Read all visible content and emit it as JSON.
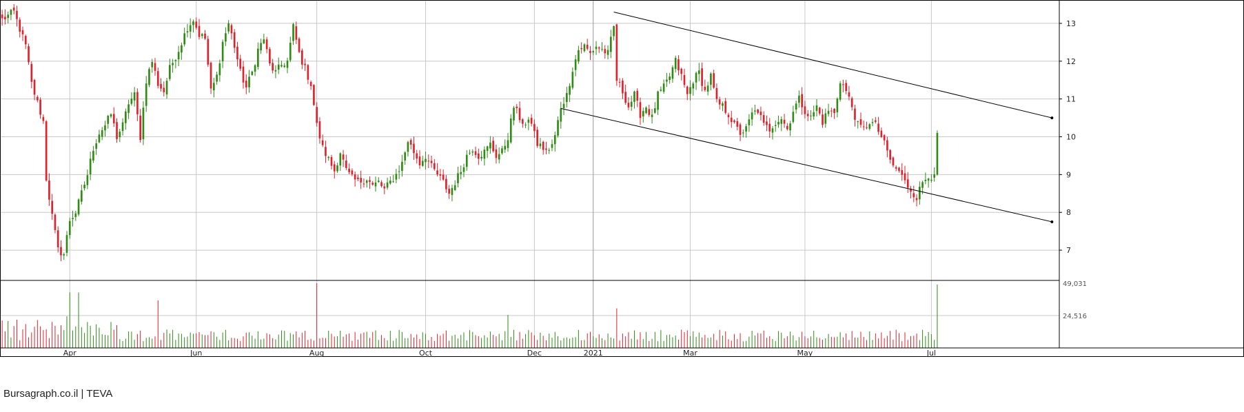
{
  "watermark": "Bursagraph.co.il | TEVA",
  "colors": {
    "up": "#2e8b14",
    "down": "#e0212b",
    "grid": "#c8c8c8",
    "frame": "#000000",
    "trend": "#000000"
  },
  "chart_data": {
    "type": "candlestick",
    "title": "",
    "ticker": "TEVA",
    "price_ylim": [
      6.2,
      13.6
    ],
    "price_ticks": [
      7,
      8,
      9,
      10,
      11,
      12,
      13
    ],
    "volume_ylim": [
      0,
      49031
    ],
    "volume_ticks": [
      "49,031",
      "24,516"
    ],
    "volume_tick_values": [
      49031,
      24516
    ],
    "x_tick_labels": [
      {
        "label": "Apr",
        "index": 23
      },
      {
        "label": "Jun",
        "index": 66
      },
      {
        "label": "Aug",
        "index": 107
      },
      {
        "label": "Oct",
        "index": 144
      },
      {
        "label": "Dec",
        "index": 181
      },
      {
        "label": "2021",
        "index": 201
      },
      {
        "label": "Mar",
        "index": 234
      },
      {
        "label": "May",
        "index": 273
      },
      {
        "label": "Jul",
        "index": 316
      }
    ],
    "grid": true,
    "last_close": 10.1,
    "anchors": [
      [
        0,
        13.1
      ],
      [
        4,
        13.3
      ],
      [
        8,
        12.4
      ],
      [
        10,
        11.4
      ],
      [
        12,
        10.9
      ],
      [
        14,
        10.4
      ],
      [
        15,
        8.9
      ],
      [
        17,
        7.9
      ],
      [
        19,
        7.0
      ],
      [
        21,
        6.9
      ],
      [
        23,
        7.8
      ],
      [
        25,
        8.0
      ],
      [
        27,
        8.5
      ],
      [
        29,
        9.0
      ],
      [
        31,
        9.7
      ],
      [
        33,
        10.1
      ],
      [
        35,
        10.3
      ],
      [
        37,
        10.6
      ],
      [
        39,
        10.0
      ],
      [
        41,
        10.3
      ],
      [
        43,
        10.9
      ],
      [
        45,
        11.1
      ],
      [
        47,
        10.0
      ],
      [
        49,
        11.5
      ],
      [
        51,
        12.0
      ],
      [
        53,
        11.4
      ],
      [
        55,
        11.2
      ],
      [
        57,
        11.8
      ],
      [
        60,
        12.3
      ],
      [
        63,
        12.9
      ],
      [
        65,
        13.1
      ],
      [
        67,
        12.7
      ],
      [
        69,
        12.6
      ],
      [
        71,
        11.2
      ],
      [
        73,
        11.6
      ],
      [
        75,
        12.5
      ],
      [
        77,
        13.0
      ],
      [
        79,
        12.4
      ],
      [
        81,
        11.7
      ],
      [
        83,
        11.3
      ],
      [
        85,
        11.7
      ],
      [
        87,
        12.3
      ],
      [
        89,
        12.6
      ],
      [
        91,
        11.9
      ],
      [
        93,
        11.7
      ],
      [
        95,
        11.9
      ],
      [
        97,
        12.0
      ],
      [
        99,
        12.9
      ],
      [
        101,
        12.2
      ],
      [
        103,
        11.8
      ],
      [
        105,
        11.4
      ],
      [
        107,
        10.3
      ],
      [
        109,
        9.7
      ],
      [
        111,
        9.4
      ],
      [
        113,
        9.1
      ],
      [
        115,
        9.6
      ],
      [
        117,
        9.1
      ],
      [
        119,
        8.9
      ],
      [
        121,
        8.8
      ],
      [
        124,
        8.9
      ],
      [
        126,
        8.7
      ],
      [
        128,
        8.8
      ],
      [
        130,
        8.6
      ],
      [
        132,
        8.8
      ],
      [
        134,
        9.0
      ],
      [
        136,
        9.3
      ],
      [
        138,
        9.9
      ],
      [
        140,
        9.6
      ],
      [
        142,
        9.3
      ],
      [
        144,
        9.5
      ],
      [
        146,
        9.2
      ],
      [
        148,
        9.0
      ],
      [
        150,
        8.8
      ],
      [
        152,
        8.5
      ],
      [
        154,
        8.8
      ],
      [
        156,
        9.1
      ],
      [
        158,
        9.5
      ],
      [
        160,
        9.7
      ],
      [
        162,
        9.5
      ],
      [
        164,
        9.6
      ],
      [
        166,
        9.8
      ],
      [
        168,
        9.5
      ],
      [
        170,
        9.6
      ],
      [
        172,
        10.0
      ],
      [
        174,
        10.8
      ],
      [
        176,
        10.5
      ],
      [
        178,
        10.3
      ],
      [
        180,
        10.4
      ],
      [
        182,
        9.8
      ],
      [
        184,
        9.7
      ],
      [
        186,
        9.6
      ],
      [
        188,
        10.0
      ],
      [
        190,
        10.8
      ],
      [
        192,
        11.1
      ],
      [
        194,
        11.8
      ],
      [
        196,
        12.3
      ],
      [
        198,
        12.4
      ],
      [
        200,
        12.2
      ],
      [
        202,
        12.4
      ],
      [
        204,
        12.3
      ],
      [
        206,
        12.2
      ],
      [
        208,
        12.9
      ],
      [
        209,
        11.5
      ],
      [
        211,
        11.2
      ],
      [
        213,
        10.8
      ],
      [
        215,
        11.1
      ],
      [
        217,
        10.6
      ],
      [
        219,
        10.8
      ],
      [
        221,
        10.5
      ],
      [
        223,
        11.1
      ],
      [
        225,
        11.3
      ],
      [
        227,
        11.6
      ],
      [
        229,
        12.0
      ],
      [
        231,
        11.6
      ],
      [
        233,
        11.1
      ],
      [
        235,
        11.5
      ],
      [
        237,
        11.7
      ],
      [
        239,
        11.2
      ],
      [
        241,
        11.6
      ],
      [
        243,
        10.9
      ],
      [
        245,
        10.8
      ],
      [
        247,
        10.6
      ],
      [
        249,
        10.3
      ],
      [
        251,
        10.1
      ],
      [
        253,
        10.2
      ],
      [
        255,
        10.6
      ],
      [
        257,
        10.7
      ],
      [
        259,
        10.3
      ],
      [
        261,
        10.2
      ],
      [
        263,
        10.4
      ],
      [
        265,
        10.5
      ],
      [
        267,
        10.2
      ],
      [
        269,
        10.7
      ],
      [
        271,
        11.0
      ],
      [
        273,
        10.7
      ],
      [
        275,
        10.5
      ],
      [
        277,
        10.8
      ],
      [
        279,
        10.4
      ],
      [
        281,
        10.7
      ],
      [
        283,
        10.6
      ],
      [
        285,
        11.5
      ],
      [
        287,
        11.2
      ],
      [
        289,
        10.8
      ],
      [
        291,
        10.3
      ],
      [
        293,
        10.2
      ],
      [
        295,
        10.4
      ],
      [
        297,
        10.3
      ],
      [
        299,
        10.0
      ],
      [
        301,
        9.6
      ],
      [
        303,
        9.2
      ],
      [
        305,
        9.1
      ],
      [
        307,
        8.8
      ],
      [
        309,
        8.6
      ],
      [
        311,
        8.4
      ],
      [
        313,
        8.8
      ],
      [
        315,
        9.0
      ],
      [
        317,
        8.9
      ],
      [
        318,
        10.1
      ]
    ]
  }
}
